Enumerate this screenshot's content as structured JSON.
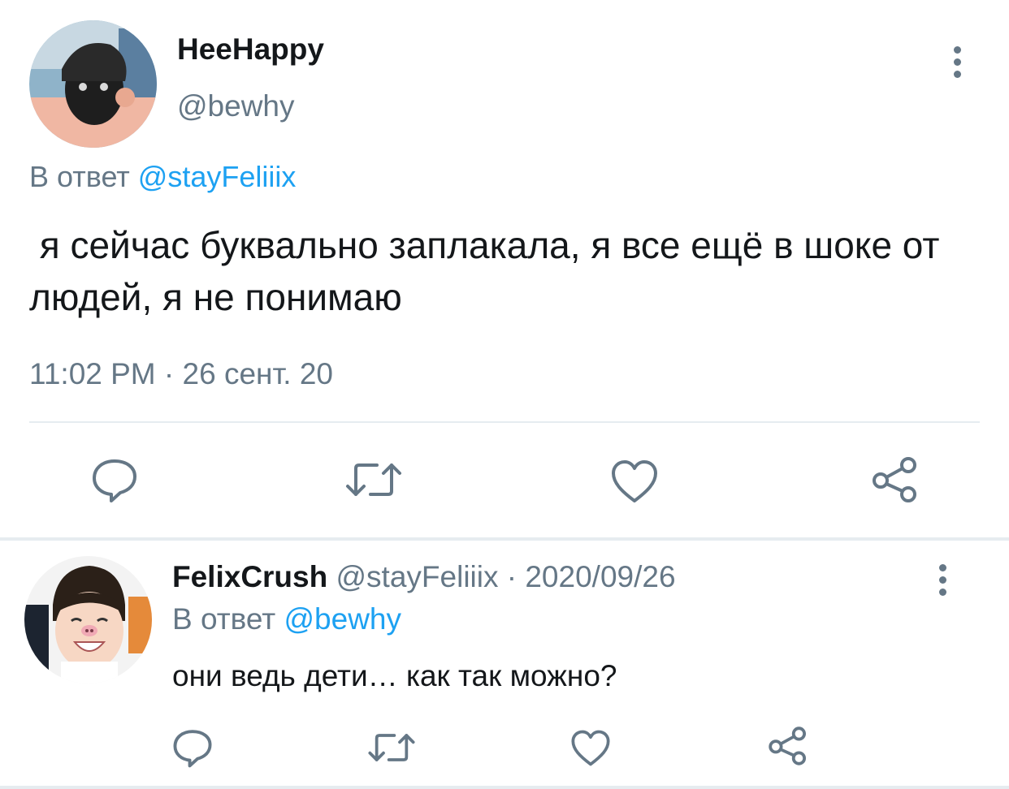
{
  "main_tweet": {
    "display_name": "HeeHappy",
    "handle": "@bewhy",
    "reply_to_prefix": "В ответ",
    "reply_to_handle": "@stayFeliiix",
    "text": " я сейчас буквально заплакала, я все ещё в шоке от людей, я не понимаю",
    "timestamp": "11:02 PM · 26 сент. 20",
    "icons": [
      "reply-icon",
      "retweet-icon",
      "like-icon",
      "share-icon",
      "more-icon"
    ]
  },
  "reply_tweet": {
    "display_name": "FelixCrush",
    "handle_date": "@stayFeliiix · 2020/09/26",
    "reply_to_prefix": "В ответ",
    "reply_to_handle": "@bewhy",
    "text": "они ведь дети… как так можно?",
    "icons": [
      "reply-icon",
      "retweet-icon",
      "like-icon",
      "share-icon",
      "more-icon"
    ]
  },
  "colors": {
    "accent": "#1da1f2",
    "secondary_text": "#657786",
    "divider": "#e6ecf0"
  }
}
